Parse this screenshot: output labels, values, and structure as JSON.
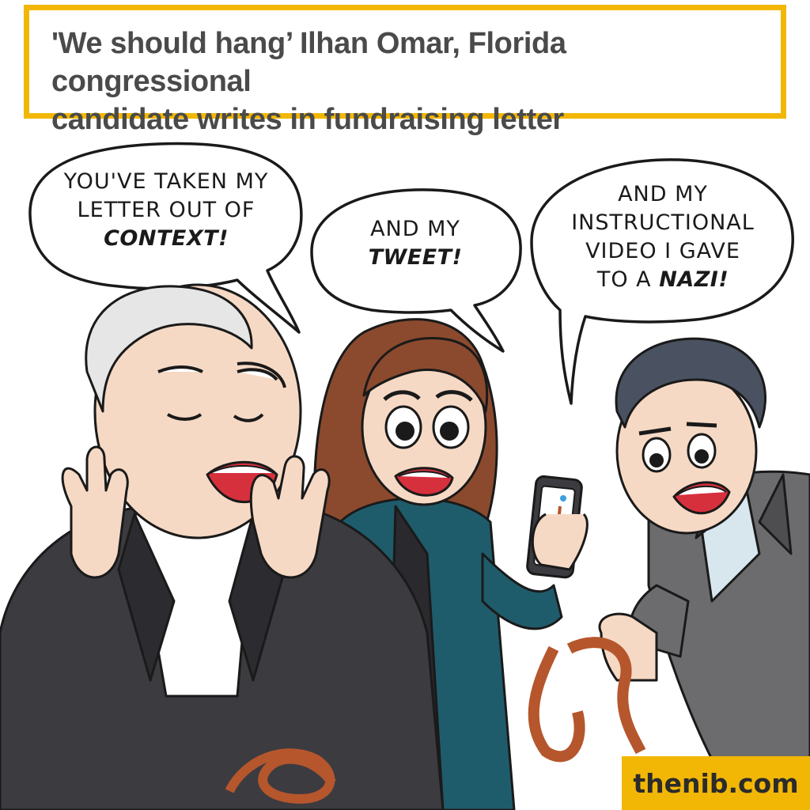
{
  "headline": "'We should hang’ Ilhan Omar,  Florida congressional\ncandidate  writes in fundraising letter",
  "bubbles": [
    {
      "line1": "YOU'VE TAKEN MY",
      "line2": "LETTER OUT OF",
      "emphasis": "CONTEXT!"
    },
    {
      "line1": "AND MY",
      "emphasis": "TWEET!"
    },
    {
      "line1": "AND MY",
      "line2": "INSTRUCTIONAL",
      "line3": "VIDEO I GAVE",
      "line4_prefix": "TO A ",
      "emphasis": "NAZI!"
    }
  ],
  "credit": "thenib.com",
  "colors": {
    "accent_yellow": "#f2b705",
    "headline_text": "#4a4a4a",
    "suit_dark": "#3b3b40",
    "suit_grey": "#6c6c6e",
    "teal_jacket": "#1f5c6b",
    "skin": "#f6d9c4",
    "rope": "#b5562c"
  }
}
